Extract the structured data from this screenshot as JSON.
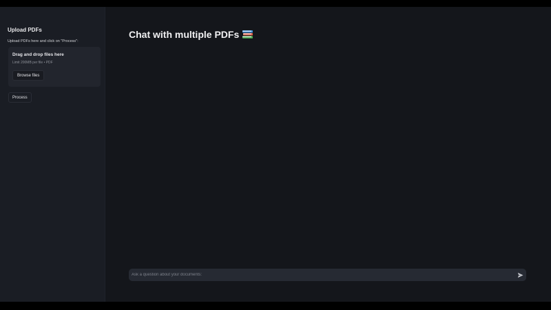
{
  "sidebar": {
    "title": "Upload PDFs",
    "hint": "Upload PDFs here and click on \"Process\":",
    "dropzone": {
      "title": "Drag and drop files here",
      "limit": "Limit 200MB per file • PDF",
      "browse_label": "Browse files"
    },
    "process_label": "Process"
  },
  "main": {
    "title": "Chat with multiple PDFs",
    "title_icon": "books-icon",
    "chat_input": {
      "placeholder": "Ask a question about your documents:",
      "value": "",
      "send_icon": "send-icon"
    }
  },
  "colors": {
    "background": "#14161b",
    "sidebar": "#1a1d24",
    "input": "#262a33"
  }
}
